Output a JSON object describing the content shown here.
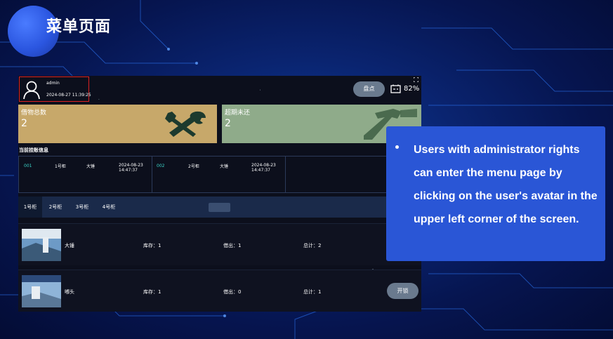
{
  "slide": {
    "title": "菜单页面"
  },
  "app": {
    "header": {
      "username": "admin",
      "datetime": "2024-08-27 11:39:25",
      "inventory_button": "盘点",
      "battery": "82%"
    },
    "cards": [
      {
        "label": "借物总数",
        "value": "2"
      },
      {
        "label": "超期未还",
        "value": "2"
      }
    ],
    "info_title": "当前挂账信息",
    "borrow_records": [
      {
        "number": "001",
        "cabinet": "1号柜",
        "item": "大锤",
        "date": "2024-08-23",
        "time": "14:47:37"
      },
      {
        "number": "002",
        "cabinet": "2号柜",
        "item": "大锤",
        "date": "2024-08-23",
        "time": "14:47:37"
      }
    ],
    "tabs": [
      "1号柜",
      "2号柜",
      "3号柜",
      "4号柜"
    ],
    "items": [
      {
        "name": "大锤",
        "stock": "库存：1",
        "lent": "借出：1",
        "total": "总计：2"
      },
      {
        "name": "嘟头",
        "stock": "库存：1",
        "lent": "借出：0",
        "total": "总计：1",
        "action": "开锁"
      }
    ]
  },
  "callout": {
    "text": "Users with administrator rights can enter the menu page by clicking on the user's avatar in the upper left corner of the screen."
  }
}
